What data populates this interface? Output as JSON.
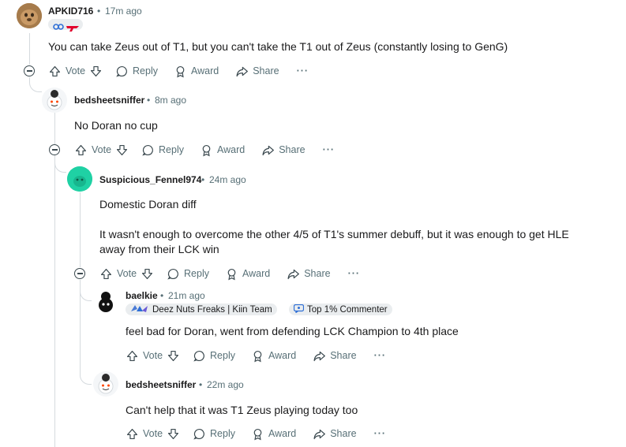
{
  "comments": [
    {
      "username": "APKID716",
      "time": "17m ago",
      "text": "You can take Zeus out of T1, but you can't take the T1 out of Zeus (constantly losing to GenG)"
    },
    {
      "username": "bedsheetsniffer",
      "time": "8m ago",
      "text": "No Doran no cup"
    },
    {
      "username": "Suspicious_Fennel974",
      "time": "24m ago",
      "text": "Domestic Doran diff",
      "text2": "It wasn't enough to overcome the other 4/5 of T1's summer debuff, but it was enough to get HLE",
      "text3": "away from their LCK win"
    },
    {
      "username": "baelkie",
      "time": "21m ago",
      "flair": "Deez Nuts Freaks | Kiin Team",
      "badge": "Top 1% Commenter",
      "text": "feel bad for Doran, went from defending LCK Champion to 4th place"
    },
    {
      "username": "bedsheetsniffer",
      "time": "22m ago",
      "text": "Can't help that it was T1 Zeus playing today too"
    }
  ],
  "actions": {
    "vote": "Vote",
    "reply": "Reply",
    "award": "Award",
    "share": "Share",
    "more": "···"
  },
  "separator": "•",
  "colors": {
    "meta": "#576f76",
    "thread_line": "#d5dade",
    "fennel_avatar": "#1fd1a4",
    "flair_bg": "#eaedef"
  }
}
